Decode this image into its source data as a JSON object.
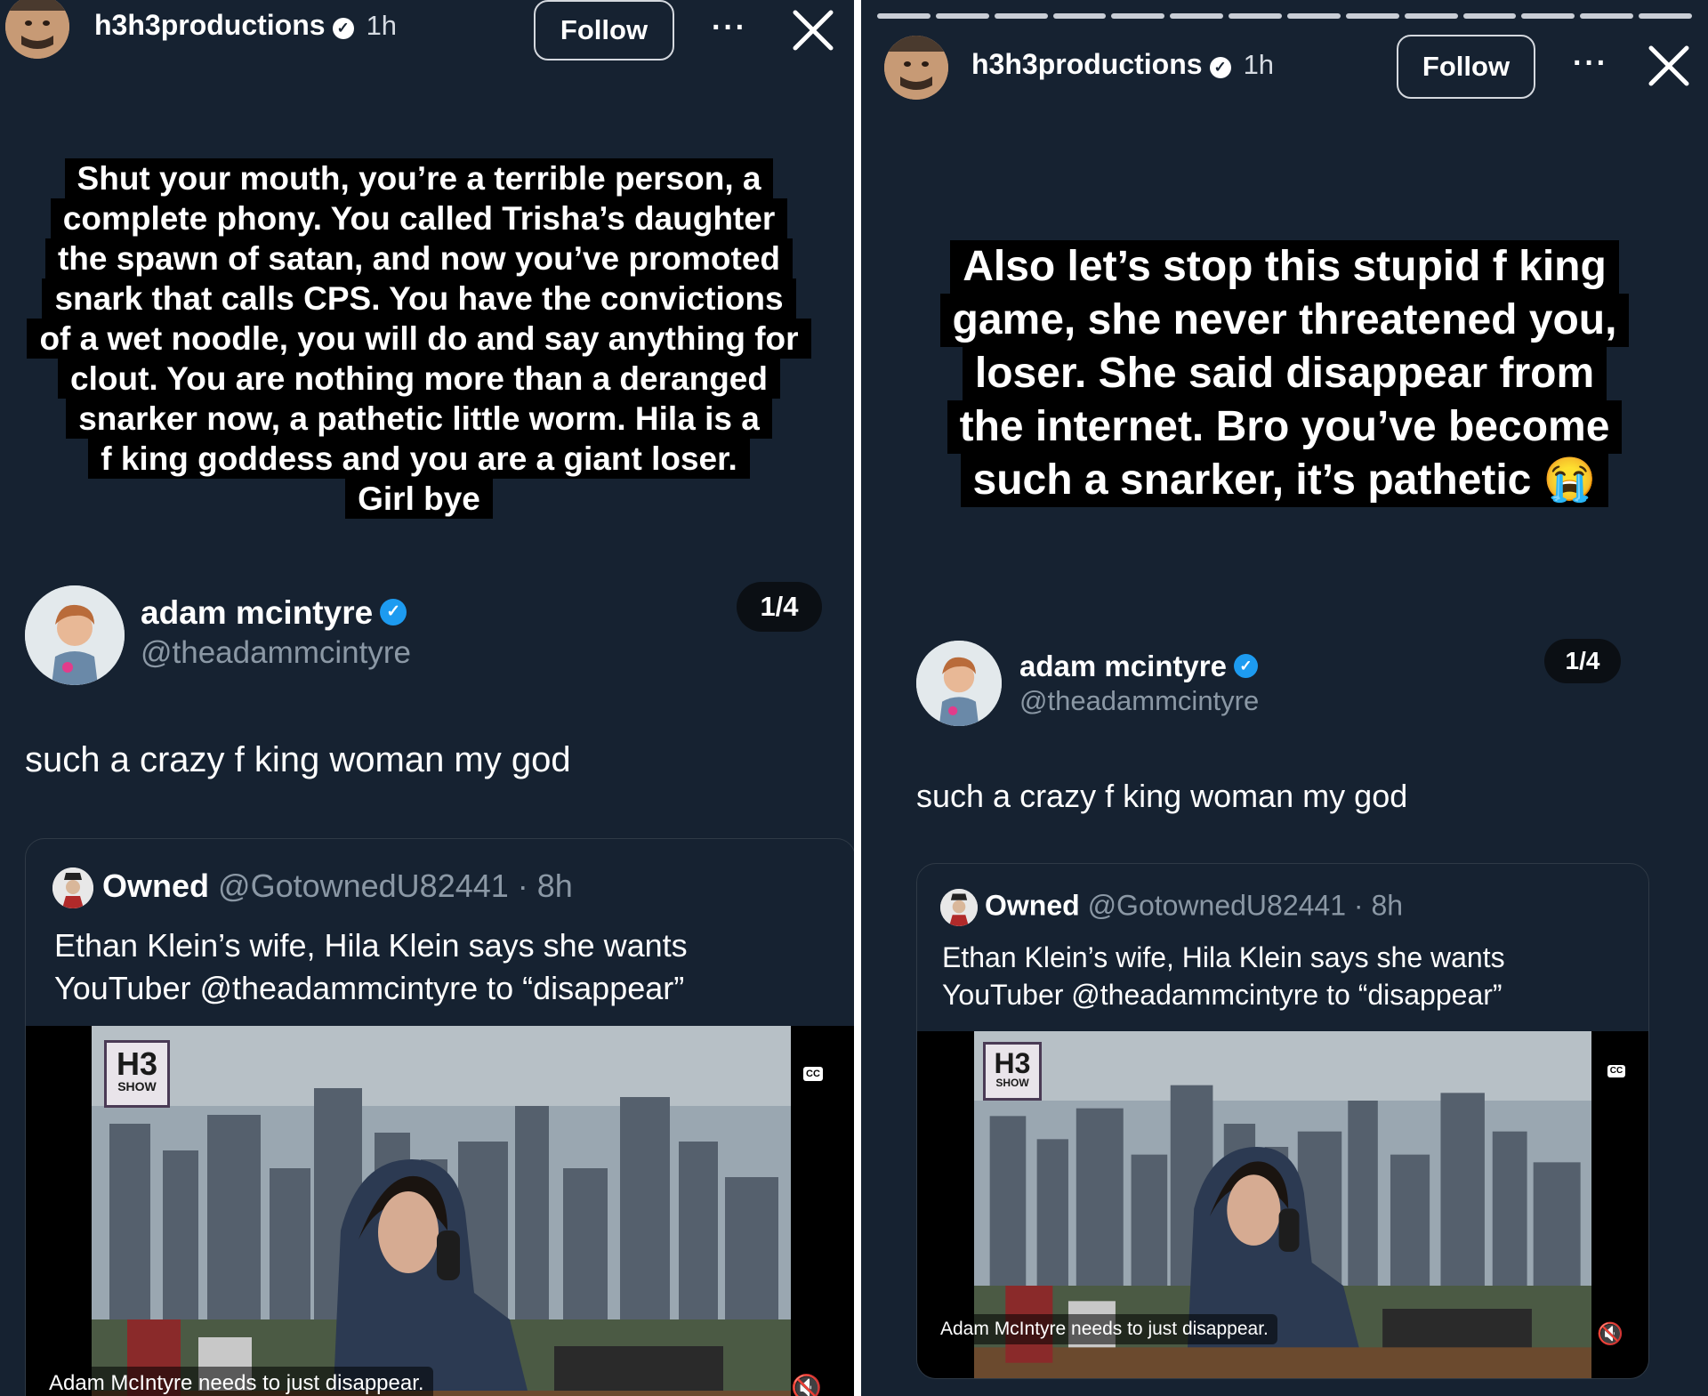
{
  "story": {
    "username": "h3h3productions",
    "time": "1h",
    "follow_label": "Follow",
    "more_label": "···"
  },
  "left_caption": [
    "Shut your mouth, you’re a terrible person, a",
    "complete phony. You called Trisha’s daughter",
    "the spawn of satan, and now you’ve promoted",
    "snark that calls CPS. You have the convictions",
    "of a wet noodle, you will do and say anything for",
    "clout. You are nothing more than a deranged",
    "snarker now, a pathetic little worm. Hila is a",
    "f    king goddess and you are a giant loser.",
    "Girl bye"
  ],
  "right_caption": [
    "Also let’s stop this stupid f    king",
    "game, she never threatened you,",
    "loser. She said disappear from",
    "the internet. Bro you’ve become",
    "such a snarker, it’s pathetic 😭"
  ],
  "tweet": {
    "name": "adam mcintyre",
    "handle": "@theadammcintyre",
    "page_badge": "1/4",
    "text_left": "such a crazy f     king woman my god",
    "text_right": "such a crazy f     king woman my god"
  },
  "quote": {
    "name": "Owned",
    "meta": "@GotownedU82441 · 8h",
    "line1": "Ethan Klein’s wife, Hila Klein says she wants",
    "line2": "YouTuber @theadammcintyre to “disappear”"
  },
  "video": {
    "logo_main": "H3",
    "logo_sub": "SHOW",
    "cc_label": "CC",
    "subtitle": "Adam McIntyre needs to just disappear.",
    "mute_label": "🔇"
  }
}
